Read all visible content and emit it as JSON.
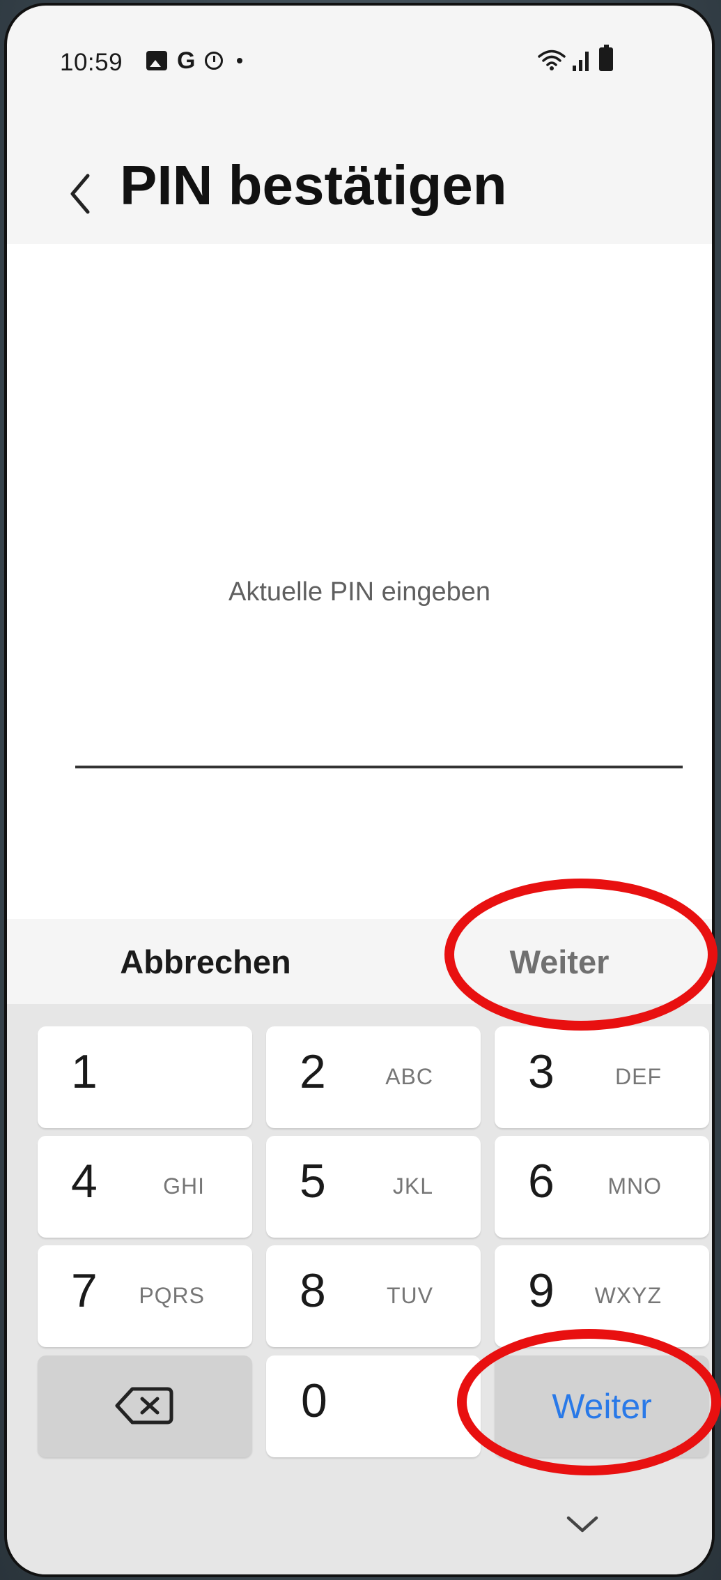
{
  "status_bar": {
    "time": "10:59",
    "icons": [
      "gallery-icon",
      "google-icon",
      "timer-icon",
      "dot-icon",
      "wifi-icon",
      "signal-icon",
      "battery-icon"
    ],
    "google_glyph": "G"
  },
  "header": {
    "title": "PIN bestätigen",
    "back_icon": "chevron-left-icon"
  },
  "content": {
    "prompt": "Aktuelle PIN eingeben",
    "pin_value": ""
  },
  "button_bar": {
    "cancel_label": "Abbrechen",
    "next_label": "Weiter"
  },
  "keypad": {
    "keys": [
      {
        "digit": "1",
        "letters": ""
      },
      {
        "digit": "2",
        "letters": "ABC"
      },
      {
        "digit": "3",
        "letters": "DEF"
      },
      {
        "digit": "4",
        "letters": "GHI"
      },
      {
        "digit": "5",
        "letters": "JKL"
      },
      {
        "digit": "6",
        "letters": "MNO"
      },
      {
        "digit": "7",
        "letters": "PQRS"
      },
      {
        "digit": "8",
        "letters": "TUV"
      },
      {
        "digit": "9",
        "letters": "WXYZ"
      }
    ],
    "zero": "0",
    "backspace_icon": "backspace-icon",
    "next_label": "Weiter",
    "hide_icon": "chevron-down-icon"
  },
  "colors": {
    "accent": "#2979e8",
    "annotation": "#e81010",
    "background": "#f5f5f5",
    "keyboard": "#e6e6e6"
  }
}
